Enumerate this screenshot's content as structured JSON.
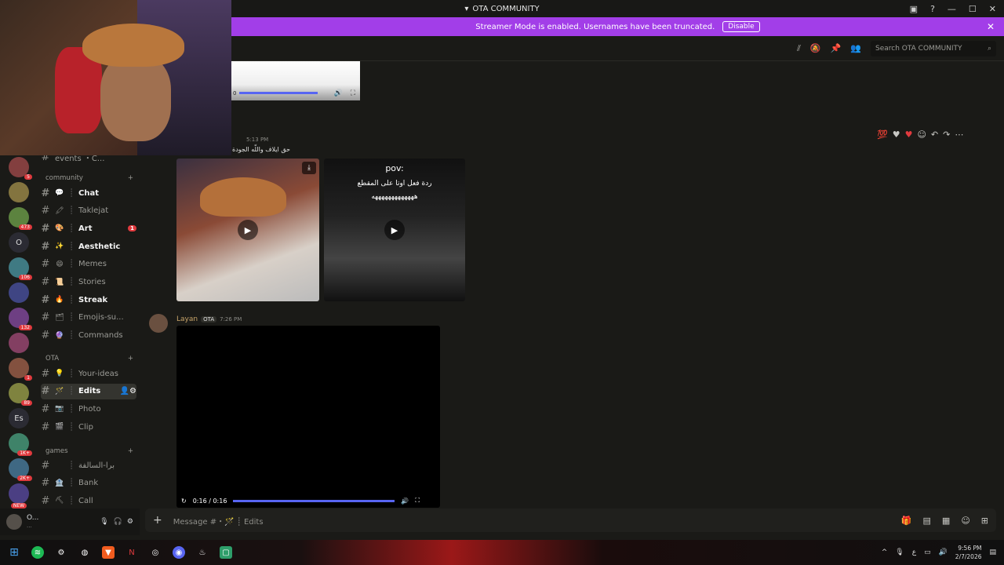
{
  "window": {
    "title": "OTA COMMUNITY"
  },
  "banner": {
    "text": "Streamer Mode is enabled. Usernames have been truncated.",
    "button": "Disable"
  },
  "header": {
    "search_placeholder": "Search OTA COMMUNITY"
  },
  "servers": [
    {
      "label": "",
      "badge": "5"
    },
    {
      "label": "",
      "badge": ""
    },
    {
      "label": "",
      "badge": "473"
    },
    {
      "label": "O",
      "badge": ""
    },
    {
      "label": "",
      "badge": "106"
    },
    {
      "label": "",
      "badge": ""
    },
    {
      "label": "",
      "badge": "132"
    },
    {
      "label": "",
      "badge": ""
    },
    {
      "label": "",
      "badge": "1"
    },
    {
      "label": "",
      "badge": "89"
    },
    {
      "label": "Es",
      "badge": ""
    },
    {
      "label": "",
      "badge": "1K+"
    },
    {
      "label": "",
      "badge": "2K+"
    },
    {
      "label": "",
      "badge": "NEW"
    }
  ],
  "channels": {
    "top_partial": "events ・C...",
    "community_label": "community",
    "community": [
      {
        "emoji": "💬",
        "name": "Chat",
        "bold": true,
        "count": ""
      },
      {
        "emoji": "🖍",
        "name": "Taklejat",
        "bold": false,
        "count": ""
      },
      {
        "emoji": "🎨",
        "name": "Art",
        "bold": true,
        "count": "1"
      },
      {
        "emoji": "✨",
        "name": "Aesthetic",
        "bold": true,
        "count": ""
      },
      {
        "emoji": "😄",
        "name": "Memes",
        "bold": false,
        "count": ""
      },
      {
        "emoji": "📜",
        "name": "Stories",
        "bold": false,
        "count": ""
      },
      {
        "emoji": "🔥",
        "name": "Streak",
        "bold": true,
        "count": ""
      },
      {
        "emoji": "🗂",
        "name": "Emojis-su...",
        "bold": false,
        "count": ""
      },
      {
        "emoji": "🔮",
        "name": "Commands",
        "bold": false,
        "count": ""
      }
    ],
    "ota_label": "OTA",
    "ota": [
      {
        "emoji": "💡",
        "name": "Your-ideas",
        "bold": false
      },
      {
        "emoji": "🪄",
        "name": "Edits",
        "bold": true
      },
      {
        "emoji": "📷",
        "name": "Photo",
        "bold": false
      },
      {
        "emoji": "🎬",
        "name": "Clip",
        "bold": false
      }
    ],
    "games_label": "games",
    "games": [
      {
        "emoji": "",
        "name": "برا-السالفة",
        "bold": false
      },
      {
        "emoji": "🏦",
        "name": "Bank",
        "bold": false
      },
      {
        "emoji": "⛏",
        "name": "Call",
        "bold": false
      }
    ]
  },
  "user": {
    "name": "O...",
    "sub": "..."
  },
  "messages": {
    "first": {
      "time": "5:13 PM",
      "text": "حق ايلاف واللّه الجودة"
    },
    "video_left_time": "0",
    "pov_title": "pov:",
    "pov_line1": "ردة فعل اوتا على المقطع",
    "pov_line2": "هههههههههههههه",
    "second": {
      "author": "Layan",
      "tag": "OTA",
      "time": "7:26 PM"
    },
    "player_time": "0:16 / 0:16"
  },
  "composer": {
    "placeholder": "Message #・🪄 ┊ Edits"
  },
  "taskbar": {
    "time": "9:56 PM",
    "date": "2/7/2026",
    "lang": "ع"
  },
  "colors": {
    "banner": "#a23ee8",
    "accent": "#5865f2",
    "badge": "#e03a3e"
  }
}
